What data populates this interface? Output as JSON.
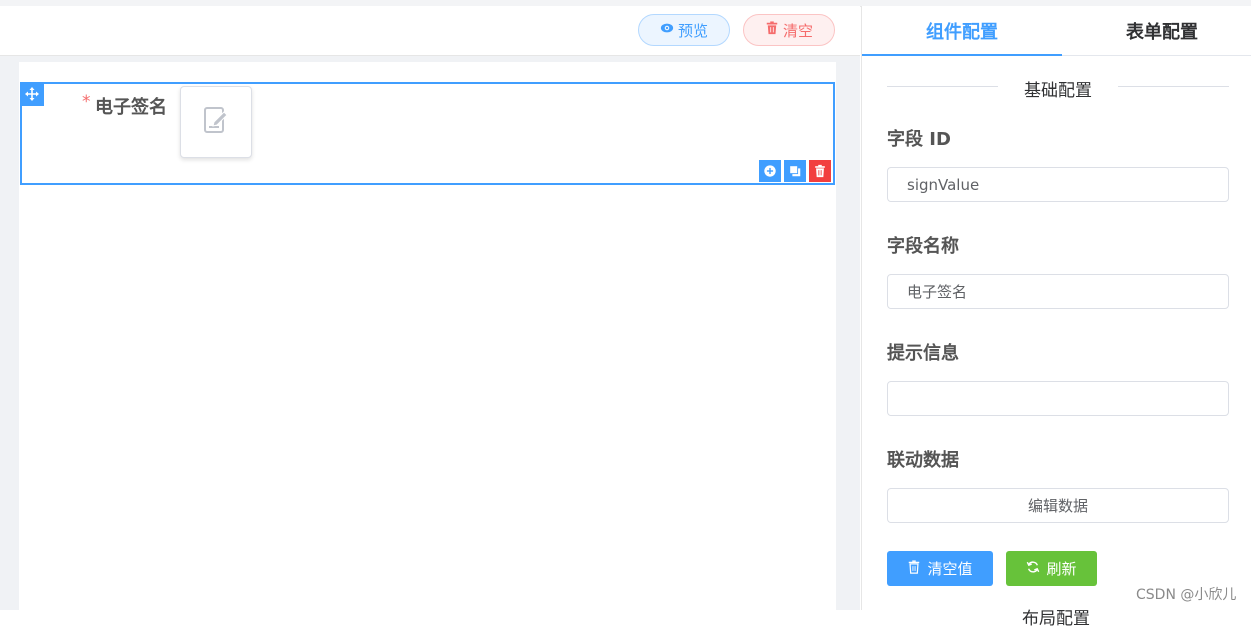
{
  "toolbar": {
    "preview_label": "预览",
    "clear_label": "清空"
  },
  "canvas": {
    "field": {
      "required_mark": "*",
      "label": "电子签名"
    }
  },
  "panel": {
    "tabs": [
      {
        "label": "组件配置",
        "active": true
      },
      {
        "label": "表单配置",
        "active": false
      }
    ],
    "section_title": "基础配置",
    "field_id_label": "字段 ID",
    "field_id_value": "signValue",
    "field_name_label": "字段名称",
    "field_name_value": "电子签名",
    "hint_label": "提示信息",
    "hint_value": "",
    "linked_label": "联动数据",
    "edit_data_label": "编辑数据",
    "clear_value_label": "清空值",
    "refresh_label": "刷新",
    "next_section_partial": "布局配置"
  },
  "watermark": "CSDN @小欣儿",
  "colors": {
    "primary": "#409eff",
    "danger": "#f56c6c",
    "success": "#67c23a"
  }
}
